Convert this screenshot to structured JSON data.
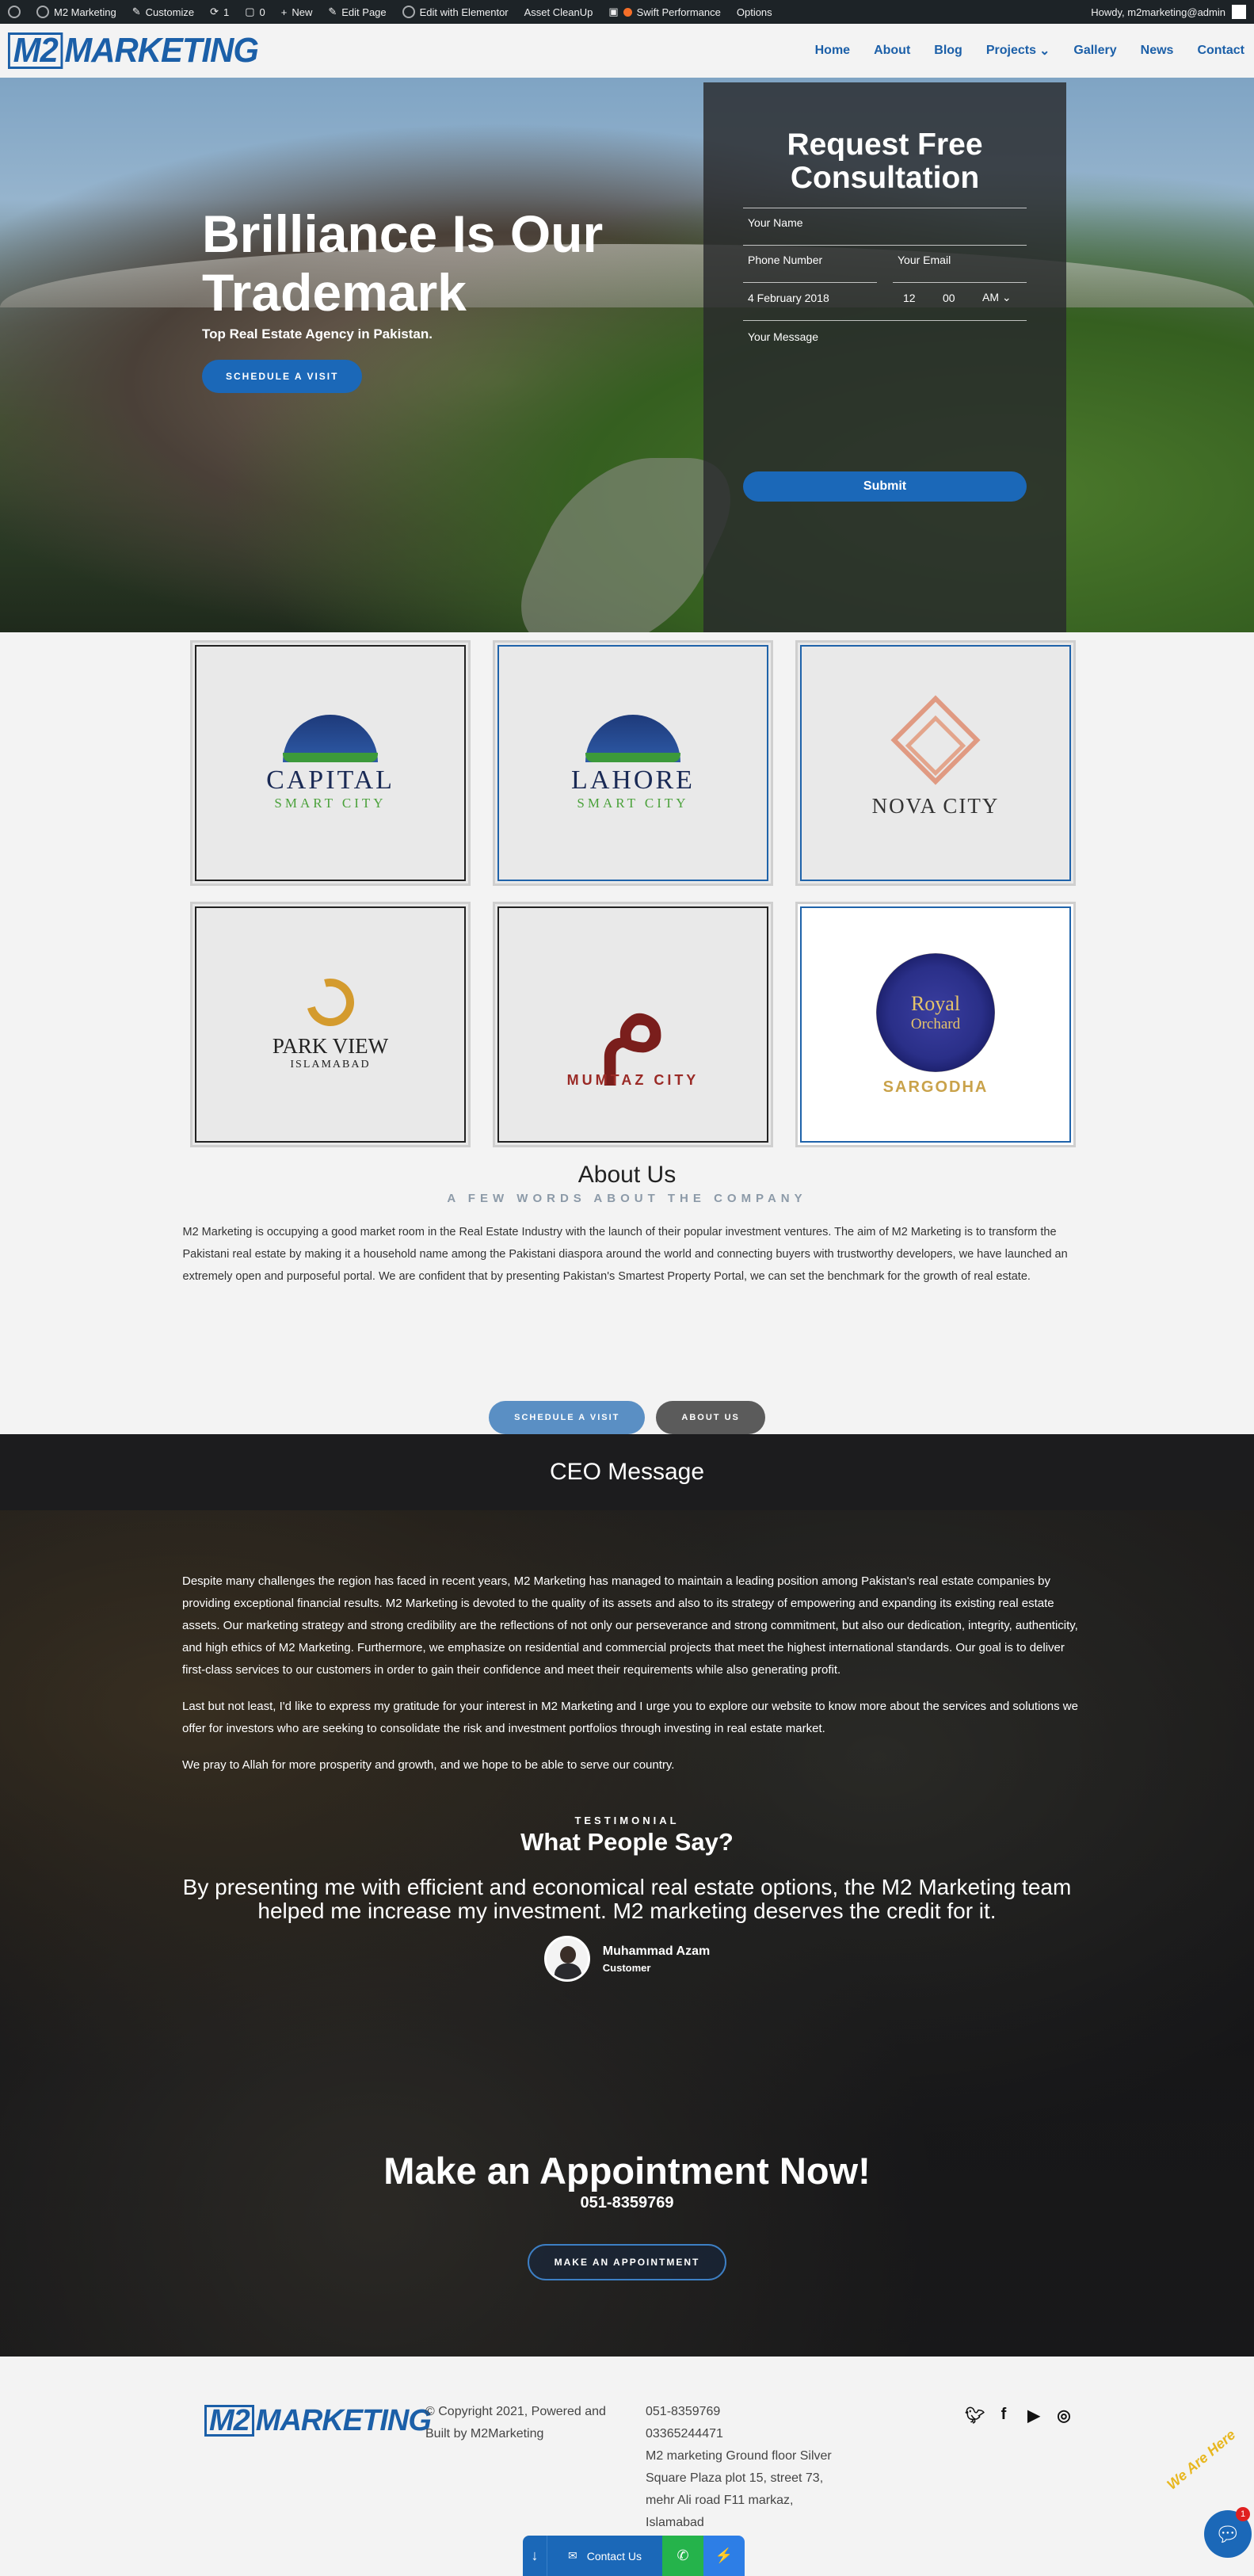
{
  "adminbar": {
    "site_name": "M2 Marketing",
    "customize": "Customize",
    "updates_count": "1",
    "comments_count": "0",
    "new": "New",
    "edit_page": "Edit Page",
    "edit_elementor": "Edit with Elementor",
    "asset_cleanup": "Asset CleanUp",
    "swift": "Swift Performance",
    "options": "Options",
    "howdy": "Howdy, m2marketing@admin"
  },
  "nav": {
    "logo_m2": "M2",
    "logo_text": "MARKETING",
    "items": [
      "Home",
      "About",
      "Blog",
      "Projects",
      "Gallery",
      "News",
      "Contact"
    ]
  },
  "hero": {
    "title": "Brilliance Is Our Trademark",
    "subtitle": "Top Real Estate Agency in Pakistan.",
    "cta": "SCHEDULE A VISIT"
  },
  "form": {
    "title": "Request Free Consultation",
    "name_ph": "Your Name",
    "phone_ph": "Phone Number",
    "email_ph": "Your Email",
    "date": "4 February 2018",
    "hour": "12",
    "minute": "00",
    "ampm": "AM",
    "message_ph": "Your Message",
    "submit": "Submit"
  },
  "projects": [
    {
      "name": "CAPITAL",
      "sub": "SMART CITY"
    },
    {
      "name": "LAHORE",
      "sub": "SMART CITY"
    },
    {
      "name": "NOVA CITY"
    },
    {
      "name": "PARK VIEW",
      "sub": "ISLAMABAD"
    },
    {
      "name": "MUMTAZ CITY"
    },
    {
      "name": "Royal",
      "sub": "Orchard",
      "place": "SARGODHA"
    }
  ],
  "about": {
    "title": "About Us",
    "kicker": "A FEW WORDS ABOUT THE COMPANY",
    "body": "M2 Marketing is occupying a good market room in the Real Estate Industry with the launch of their popular investment ventures. The aim of M2 Marketing is to transform the Pakistani real estate by making it a household name among the Pakistani diaspora around the world and connecting buyers with trustworthy developers, we have launched an extremely open and purposeful portal. We are confident that by presenting Pakistan's Smartest Property Portal, we can set the benchmark for the growth of real estate.",
    "btn_visit": "SCHEDULE A VISIT",
    "btn_about": "ABOUT US"
  },
  "ceo": {
    "title": "CEO Message",
    "p1": "Despite many challenges the region has faced in recent years, M2 Marketing has managed to maintain a leading position among Pakistan's real estate companies by providing exceptional financial results. M2 Marketing is devoted to the quality of its assets and also to its strategy of empowering and expanding its existing real estate assets. Our marketing strategy and strong credibility are the reflections of not only our perseverance and strong commitment, but also our dedication, integrity, authenticity, and high ethics of M2 Marketing. Furthermore, we emphasize on residential and commercial projects that meet the highest international standards. Our goal is to deliver first-class services to our customers in order to gain their confidence and meet their requirements while also generating profit.",
    "p2": "Last but not least, I'd like to express my gratitude for your interest in M2 Marketing and I urge you to explore our website to know more about the services and solutions we offer for investors who are seeking to consolidate the risk and investment portfolios through investing in real estate market.",
    "p3": "We pray to Allah for more prosperity and growth, and we hope to be able to serve our country."
  },
  "testimonial": {
    "label": "TESTIMONIAL",
    "title": "What People Say?",
    "quote": "By presenting me with efficient and economical real estate options, the M2 Marketing team helped me increase my investment. M2 marketing deserves the credit for it.",
    "name": "Muhammad Azam",
    "role": "Customer"
  },
  "appointment": {
    "title": "Make an Appointment Now!",
    "phone": "051-8359769",
    "btn": "MAKE AN APPOINTMENT"
  },
  "footer": {
    "copyright": "© Copyright 2021, Powered and Built by M2Marketing",
    "phone1": "051-8359769",
    "phone2": "03365244471",
    "address": "M2 marketing Ground floor Silver Square Plaza plot 15, street 73, mehr Ali road F11 markaz, Islamabad",
    "social": [
      "twitter-icon",
      "facebook-icon",
      "youtube-icon",
      "instagram-icon"
    ]
  },
  "chat": {
    "contact": "Contact Us",
    "badge": "1",
    "widget_text": "We Are Here"
  },
  "colors": {
    "brand_blue": "#1b5fa8",
    "button_blue": "#1b68b8",
    "whatsapp_green": "#25b34b"
  }
}
